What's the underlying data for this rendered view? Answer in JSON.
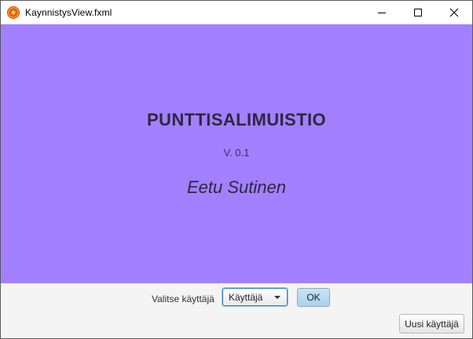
{
  "window": {
    "title": "KaynnistysView.fxml",
    "icon": "app-icon"
  },
  "controls": {
    "minimize": "minimize-icon",
    "maximize": "maximize-icon",
    "close": "close-icon"
  },
  "splash": {
    "title": "PUNTTISALIMUISTIO",
    "version": "V. 0.1",
    "author": "Eetu Sutinen",
    "background": "#a280ff"
  },
  "user_bar": {
    "label": "Valitse käyttäjä",
    "dropdown_value": "Käyttäjä",
    "ok_label": "OK",
    "new_user_label": "Uusi käyttäjä"
  }
}
